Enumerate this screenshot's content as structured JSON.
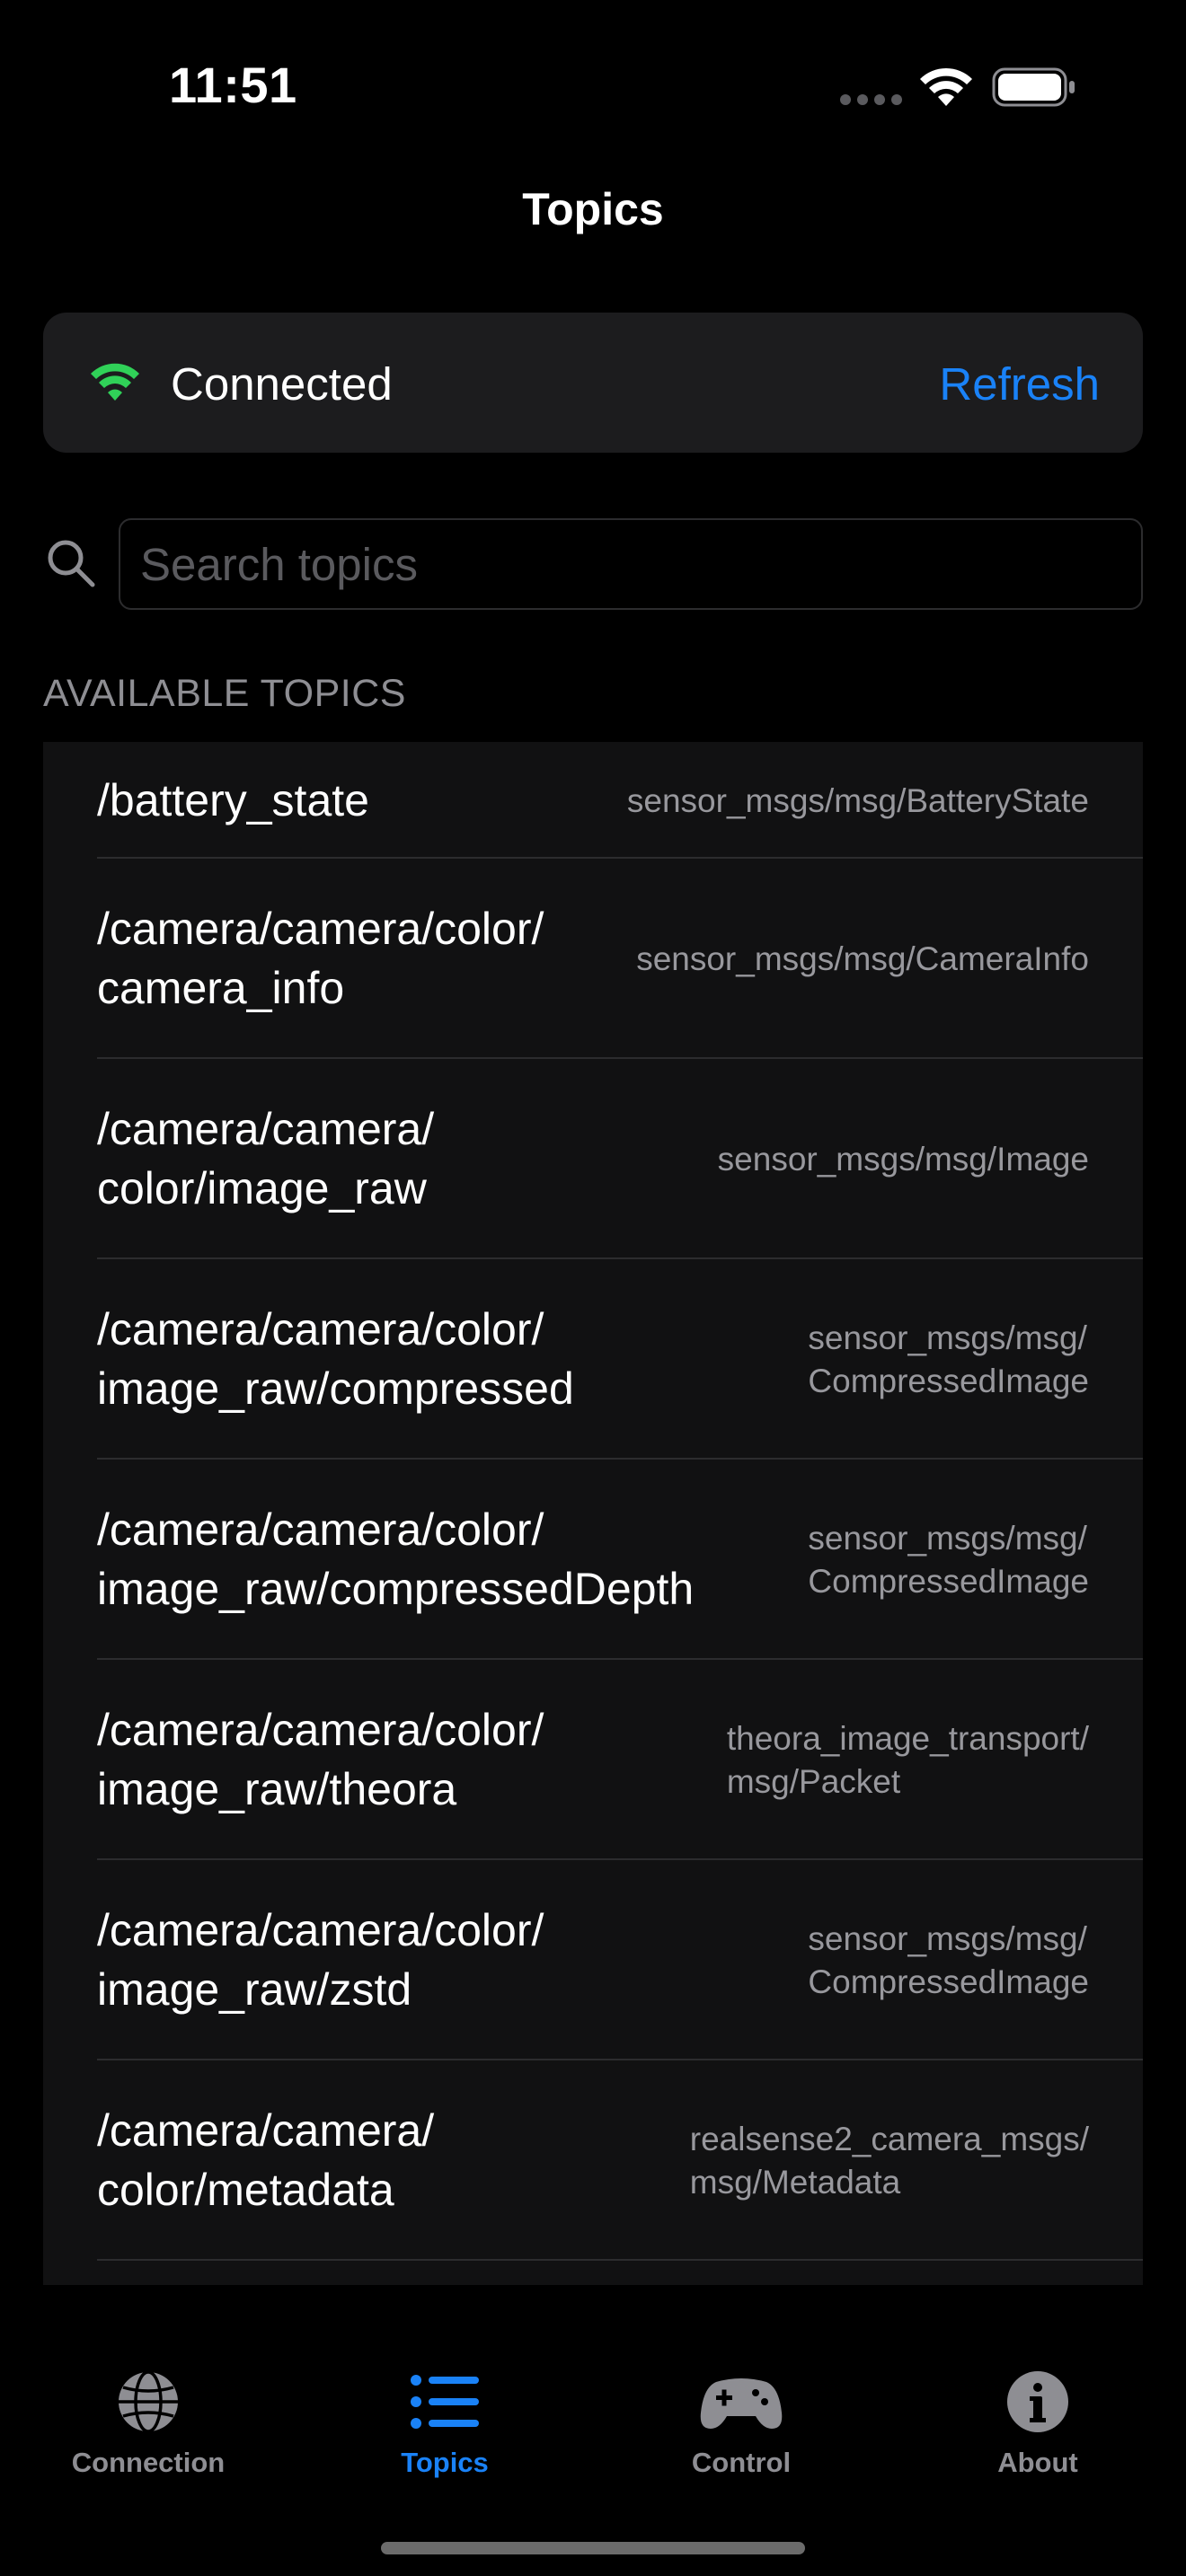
{
  "status_bar": {
    "time": "11:51"
  },
  "nav": {
    "title": "Topics"
  },
  "connection": {
    "status": "Connected",
    "refresh_label": "Refresh",
    "status_color": "#30d158",
    "accent": "#1a82f7"
  },
  "search": {
    "placeholder": "Search topics",
    "value": ""
  },
  "section": {
    "header": "AVAILABLE TOPICS"
  },
  "topics": [
    {
      "name": "/battery_state",
      "type": "sensor_msgs/msg/BatteryState"
    },
    {
      "name": "/camera/camera/color/\ncamera_info",
      "type": "sensor_msgs/msg/CameraInfo"
    },
    {
      "name": "/camera/camera/\ncolor/image_raw",
      "type": "sensor_msgs/msg/Image"
    },
    {
      "name": "/camera/camera/color/\nimage_raw/compressed",
      "type": "sensor_msgs/msg/\nCompressedImage"
    },
    {
      "name": "/camera/camera/color/\nimage_raw/compressedDepth",
      "type": "sensor_msgs/msg/\nCompressedImage"
    },
    {
      "name": "/camera/camera/color/\nimage_raw/theora",
      "type": "theora_image_transport/\nmsg/Packet"
    },
    {
      "name": "/camera/camera/color/\nimage_raw/zstd",
      "type": "sensor_msgs/msg/\nCompressedImage"
    },
    {
      "name": "/camera/camera/\ncolor/metadata",
      "type": "realsense2_camera_msgs/\nmsg/Metadata"
    }
  ],
  "tab_bar": {
    "tabs": [
      {
        "label": "Connection",
        "icon": "globe-icon",
        "active": false
      },
      {
        "label": "Topics",
        "icon": "list-icon",
        "active": true
      },
      {
        "label": "Control",
        "icon": "gamecontroller-icon",
        "active": false
      },
      {
        "label": "About",
        "icon": "info-icon",
        "active": false
      }
    ]
  }
}
